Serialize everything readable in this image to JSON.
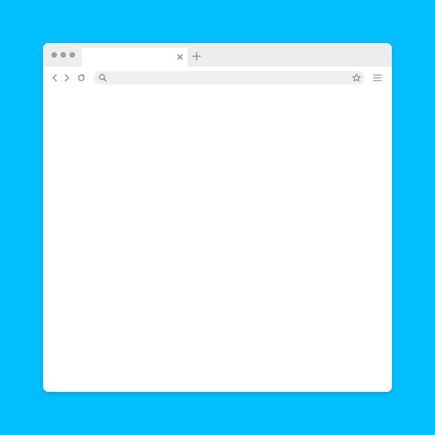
{
  "colors": {
    "background": "#00BFFF",
    "window": "#FFFFFF",
    "tabstrip": "#EDEDED",
    "addressbar": "#EFEFEF",
    "icon": "#8A8A8A",
    "dots": "#9E9E9E"
  },
  "window_controls": [
    "dot-1",
    "dot-2",
    "dot-3"
  ],
  "tab": {
    "title": "",
    "close_icon": "close-icon"
  },
  "new_tab_icon": "plus-icon",
  "toolbar": {
    "back_icon": "chevron-left-icon",
    "forward_icon": "chevron-right-icon",
    "reload_icon": "reload-icon",
    "menu_icon": "hamburger-menu-icon"
  },
  "addressbar": {
    "value": "",
    "placeholder": "",
    "search_icon": "search-icon",
    "bookmark_icon": "star-icon"
  },
  "content": {
    "text": ""
  }
}
